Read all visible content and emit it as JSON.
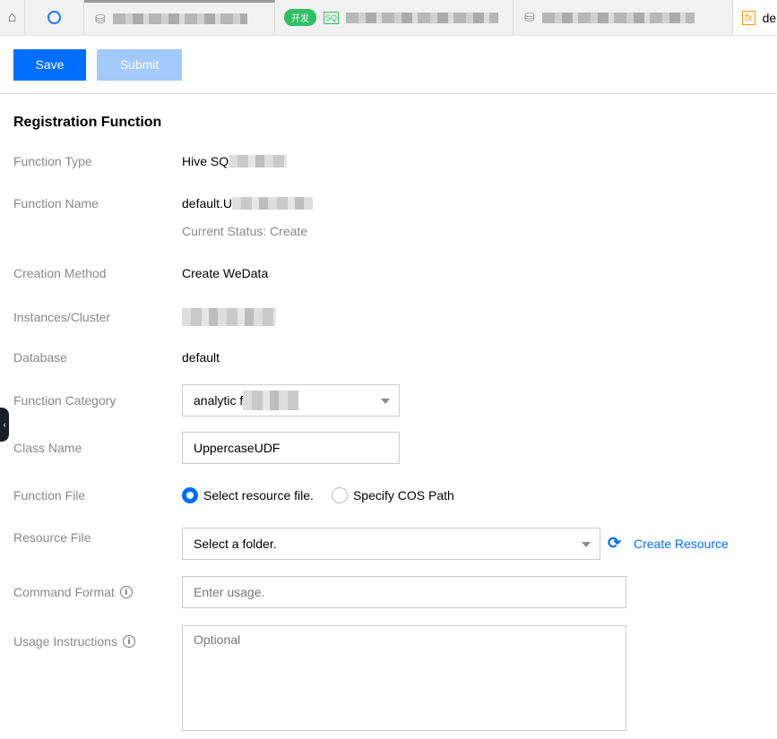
{
  "tabs": {
    "dev_badge": "开发",
    "sql_icon": "SQ",
    "active_tab_prefix": "de",
    "fx_icon": "fx"
  },
  "toolbar": {
    "save": "Save",
    "submit": "Submit"
  },
  "form": {
    "title": "Registration Function",
    "function_type": {
      "label": "Function Type",
      "value": "Hive SQ"
    },
    "function_name": {
      "label": "Function Name",
      "value": "default.U",
      "status": "Current Status: Create"
    },
    "creation_method": {
      "label": "Creation Method",
      "value": "Create WeData"
    },
    "instances": {
      "label": "Instances/Cluster"
    },
    "database": {
      "label": "Database",
      "value": "default"
    },
    "category": {
      "label": "Function Category",
      "value": "analytic f"
    },
    "class_name": {
      "label": "Class Name",
      "value": "UppercaseUDF"
    },
    "function_file": {
      "label": "Function File",
      "option1": "Select resource file.",
      "option2": "Specify COS Path"
    },
    "resource_file": {
      "label": "Resource File",
      "value": "Select a folder.",
      "create": "Create Resource"
    },
    "command_format": {
      "label": "Command Format",
      "placeholder": "Enter usage."
    },
    "usage": {
      "label": "Usage Instructions",
      "placeholder": "Optional"
    }
  },
  "colors": {
    "primary": "#006eff",
    "disabled": "#a3c9fb"
  }
}
